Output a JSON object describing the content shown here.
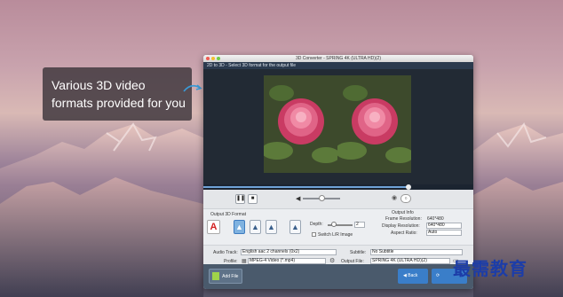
{
  "callout": {
    "line1": "Various 3D video",
    "line2": "formats provided for you"
  },
  "window": {
    "title": "3D Converter - SPRING 4K (ULTRA HD)(2)",
    "header": "2D to 3D - Select 3D format for the output file"
  },
  "controls": {
    "play_icon": "pause-icon",
    "stop_icon": "stop-icon",
    "volume_level": 0.45
  },
  "output_format": {
    "label": "Output 3D Format",
    "formats": [
      "A",
      "▲",
      "▲",
      "▲",
      "▲"
    ],
    "depth_label": "Depth:",
    "depth_value": "2",
    "switch_label": "Switch L/R Image"
  },
  "output_info": {
    "label": "Output Info",
    "frame_resolution_label": "Frame Resolution:",
    "frame_resolution_value": "640*480",
    "display_resolution_label": "Display Resolution:",
    "display_resolution_value": "640*480",
    "aspect_ratio_label": "Aspect Ratio:",
    "aspect_ratio_value": "Auto"
  },
  "settings": {
    "audio_track_label": "Audio Track:",
    "audio_track_value": "English aac 2 channels (0x2)",
    "subtitle_label": "Subtitle:",
    "subtitle_value": "No Subtitle",
    "profile_label": "Profile:",
    "profile_value": "MPEG-4 Video (*.mp4)",
    "output_file_label": "Output File:",
    "output_file_value": "SPRING 4K (ULTRA HD)(2)"
  },
  "footer": {
    "add_file": "Add File",
    "back": "Back"
  },
  "watermark": "最需教育",
  "colors": {
    "accent": "#3a7ec9",
    "header_bg": "#2b3a4e",
    "footer_bg": "#4a5a6c"
  }
}
